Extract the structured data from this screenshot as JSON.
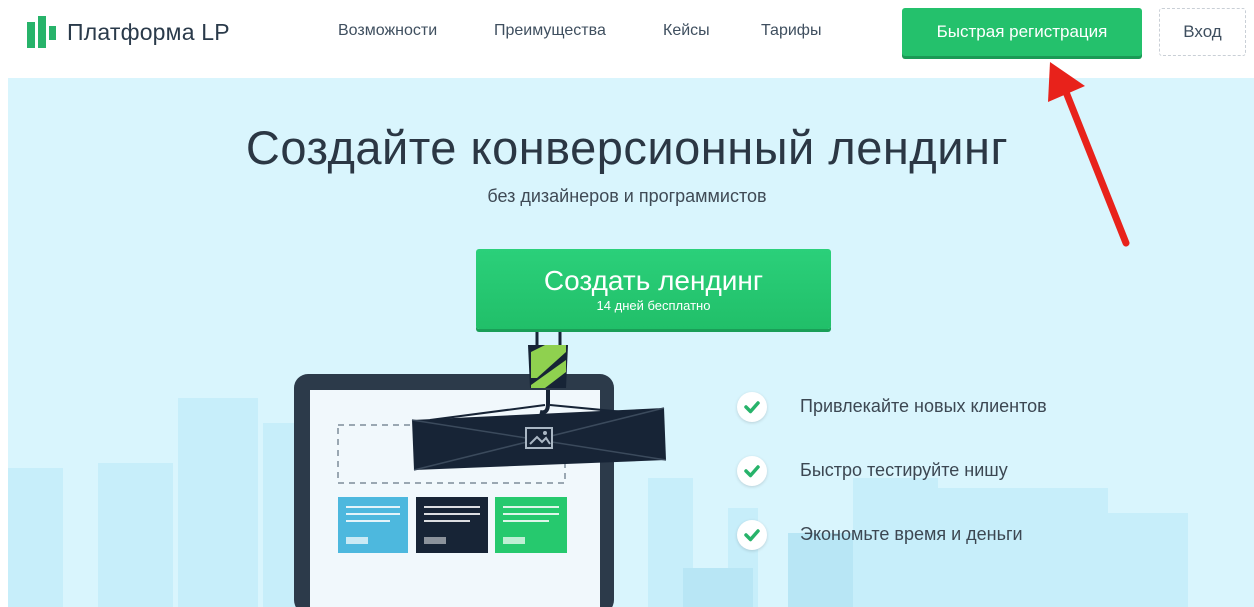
{
  "brand": {
    "name": "Платформа LP",
    "color": "#27b36a"
  },
  "nav": {
    "links": [
      "Возможности",
      "Преимущества",
      "Кейсы",
      "Тарифы"
    ],
    "register_label": "Быстрая регистрация",
    "login_label": "Вход"
  },
  "hero": {
    "title": "Создайте конверсионный лендинг",
    "subtitle": "без дизайнеров и программистов",
    "cta_label": "Создать лендинг",
    "cta_note": "14 дней бесплатно",
    "features": [
      "Привлекайте новых клиентов",
      "Быстро тестируйте нишу",
      "Экономьте время и деньги"
    ]
  },
  "icons": {
    "check": "check-icon",
    "image": "image-icon",
    "hook": "crane-hook-icon",
    "arrow": "red-arrow-icon"
  },
  "colors": {
    "accent_green": "#24c16c",
    "hero_bg": "#d9f5fd",
    "dark_navy": "#172436",
    "arrow_red": "#e8221b",
    "card_blue": "#4db8de",
    "card_green": "#26c96e"
  }
}
